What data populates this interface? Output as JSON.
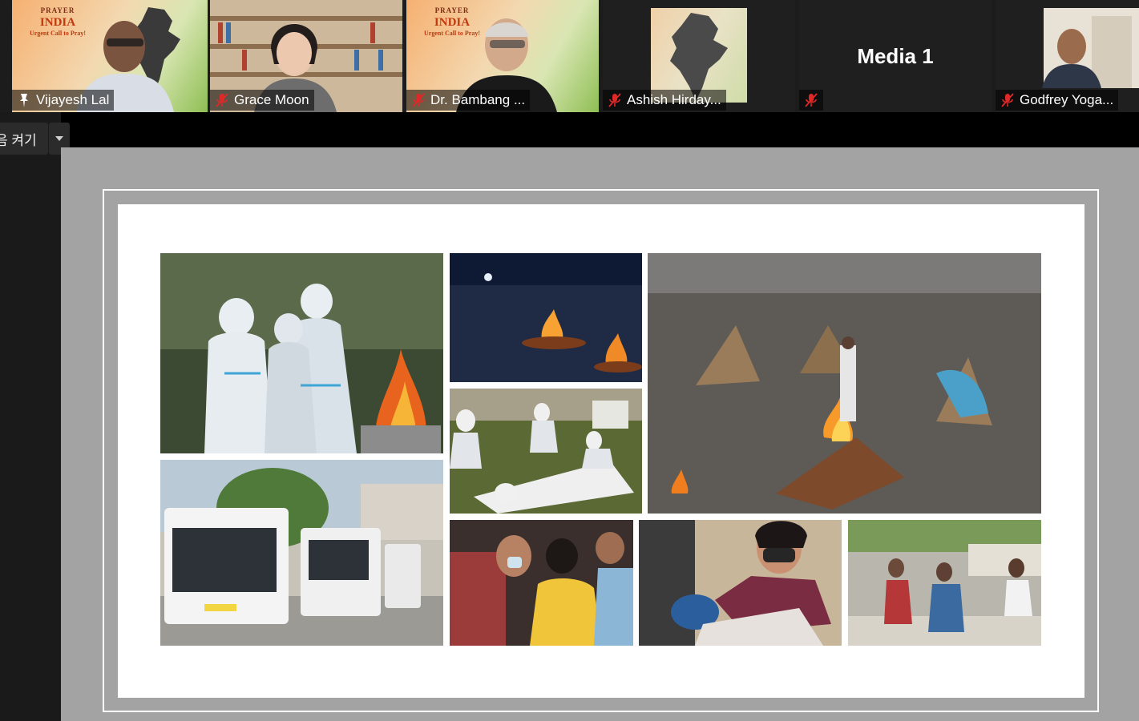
{
  "participants": [
    {
      "name": "Vijayesh Lal",
      "pinned": true,
      "muted": false,
      "active_speaker": true
    },
    {
      "name": "Grace Moon",
      "muted": true
    },
    {
      "name": "Dr. Bambang ...",
      "muted": true
    },
    {
      "name": "Ashish Hirday...",
      "muted": true
    },
    {
      "name": "",
      "muted": true,
      "media_label": "Media 1"
    },
    {
      "name": "Godfrey Yoga...",
      "muted": true
    }
  ],
  "poster": {
    "line1": "PRAYER",
    "line2": "INDIA",
    "line3": "Urgent Call to Pray!"
  },
  "side_button": {
    "label": "음 켜기"
  },
  "slide": {
    "photos": [
      "hazmat-mourners-photo",
      "night-pyres-photo",
      "crematorium-field-photo",
      "workers-with-body-photo",
      "ambulance-line-photo",
      "grieving-family-photo",
      "patient-in-car-photo",
      "waiting-outside-hospital-photo"
    ]
  },
  "colors": {
    "active_border": "#7cc04a",
    "share_bg": "#a3a3a3"
  }
}
